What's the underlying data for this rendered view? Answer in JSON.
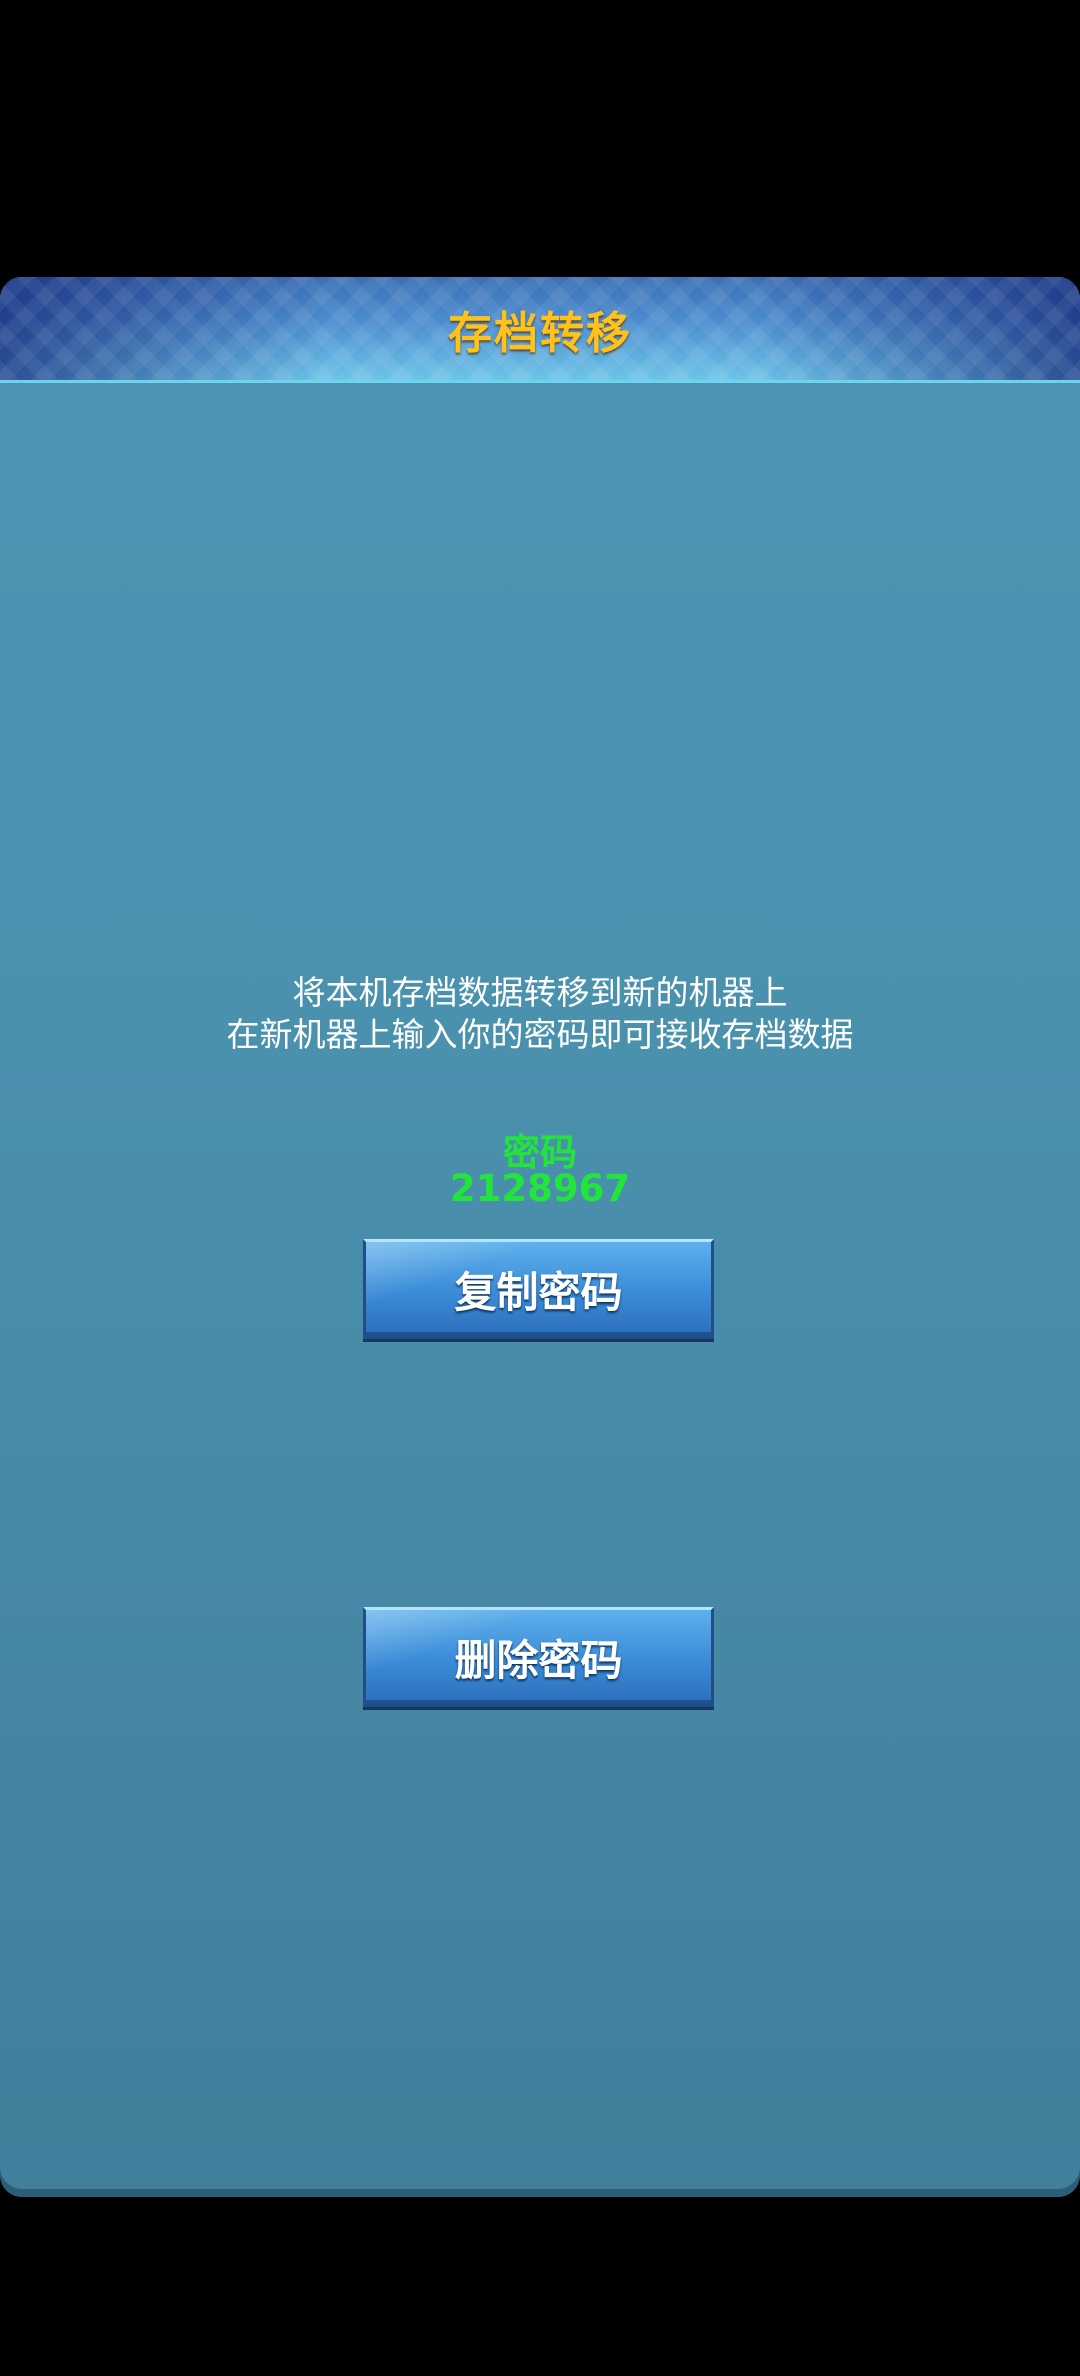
{
  "header": {
    "title": "存档转移"
  },
  "description": {
    "line1": "将本机存档数据转移到新的机器上",
    "line2": "在新机器上输入你的密码即可接收存档数据"
  },
  "password": {
    "label": "密码",
    "value": "2128967"
  },
  "buttons": {
    "copy_label": "复制密码",
    "delete_label": "删除密码"
  },
  "icons": {
    "back": "back-arrow-icon"
  },
  "colors": {
    "title": "#ffc21a",
    "password": "#22e53a",
    "panel": "#4a91ae",
    "button": "#3a8bd6"
  }
}
